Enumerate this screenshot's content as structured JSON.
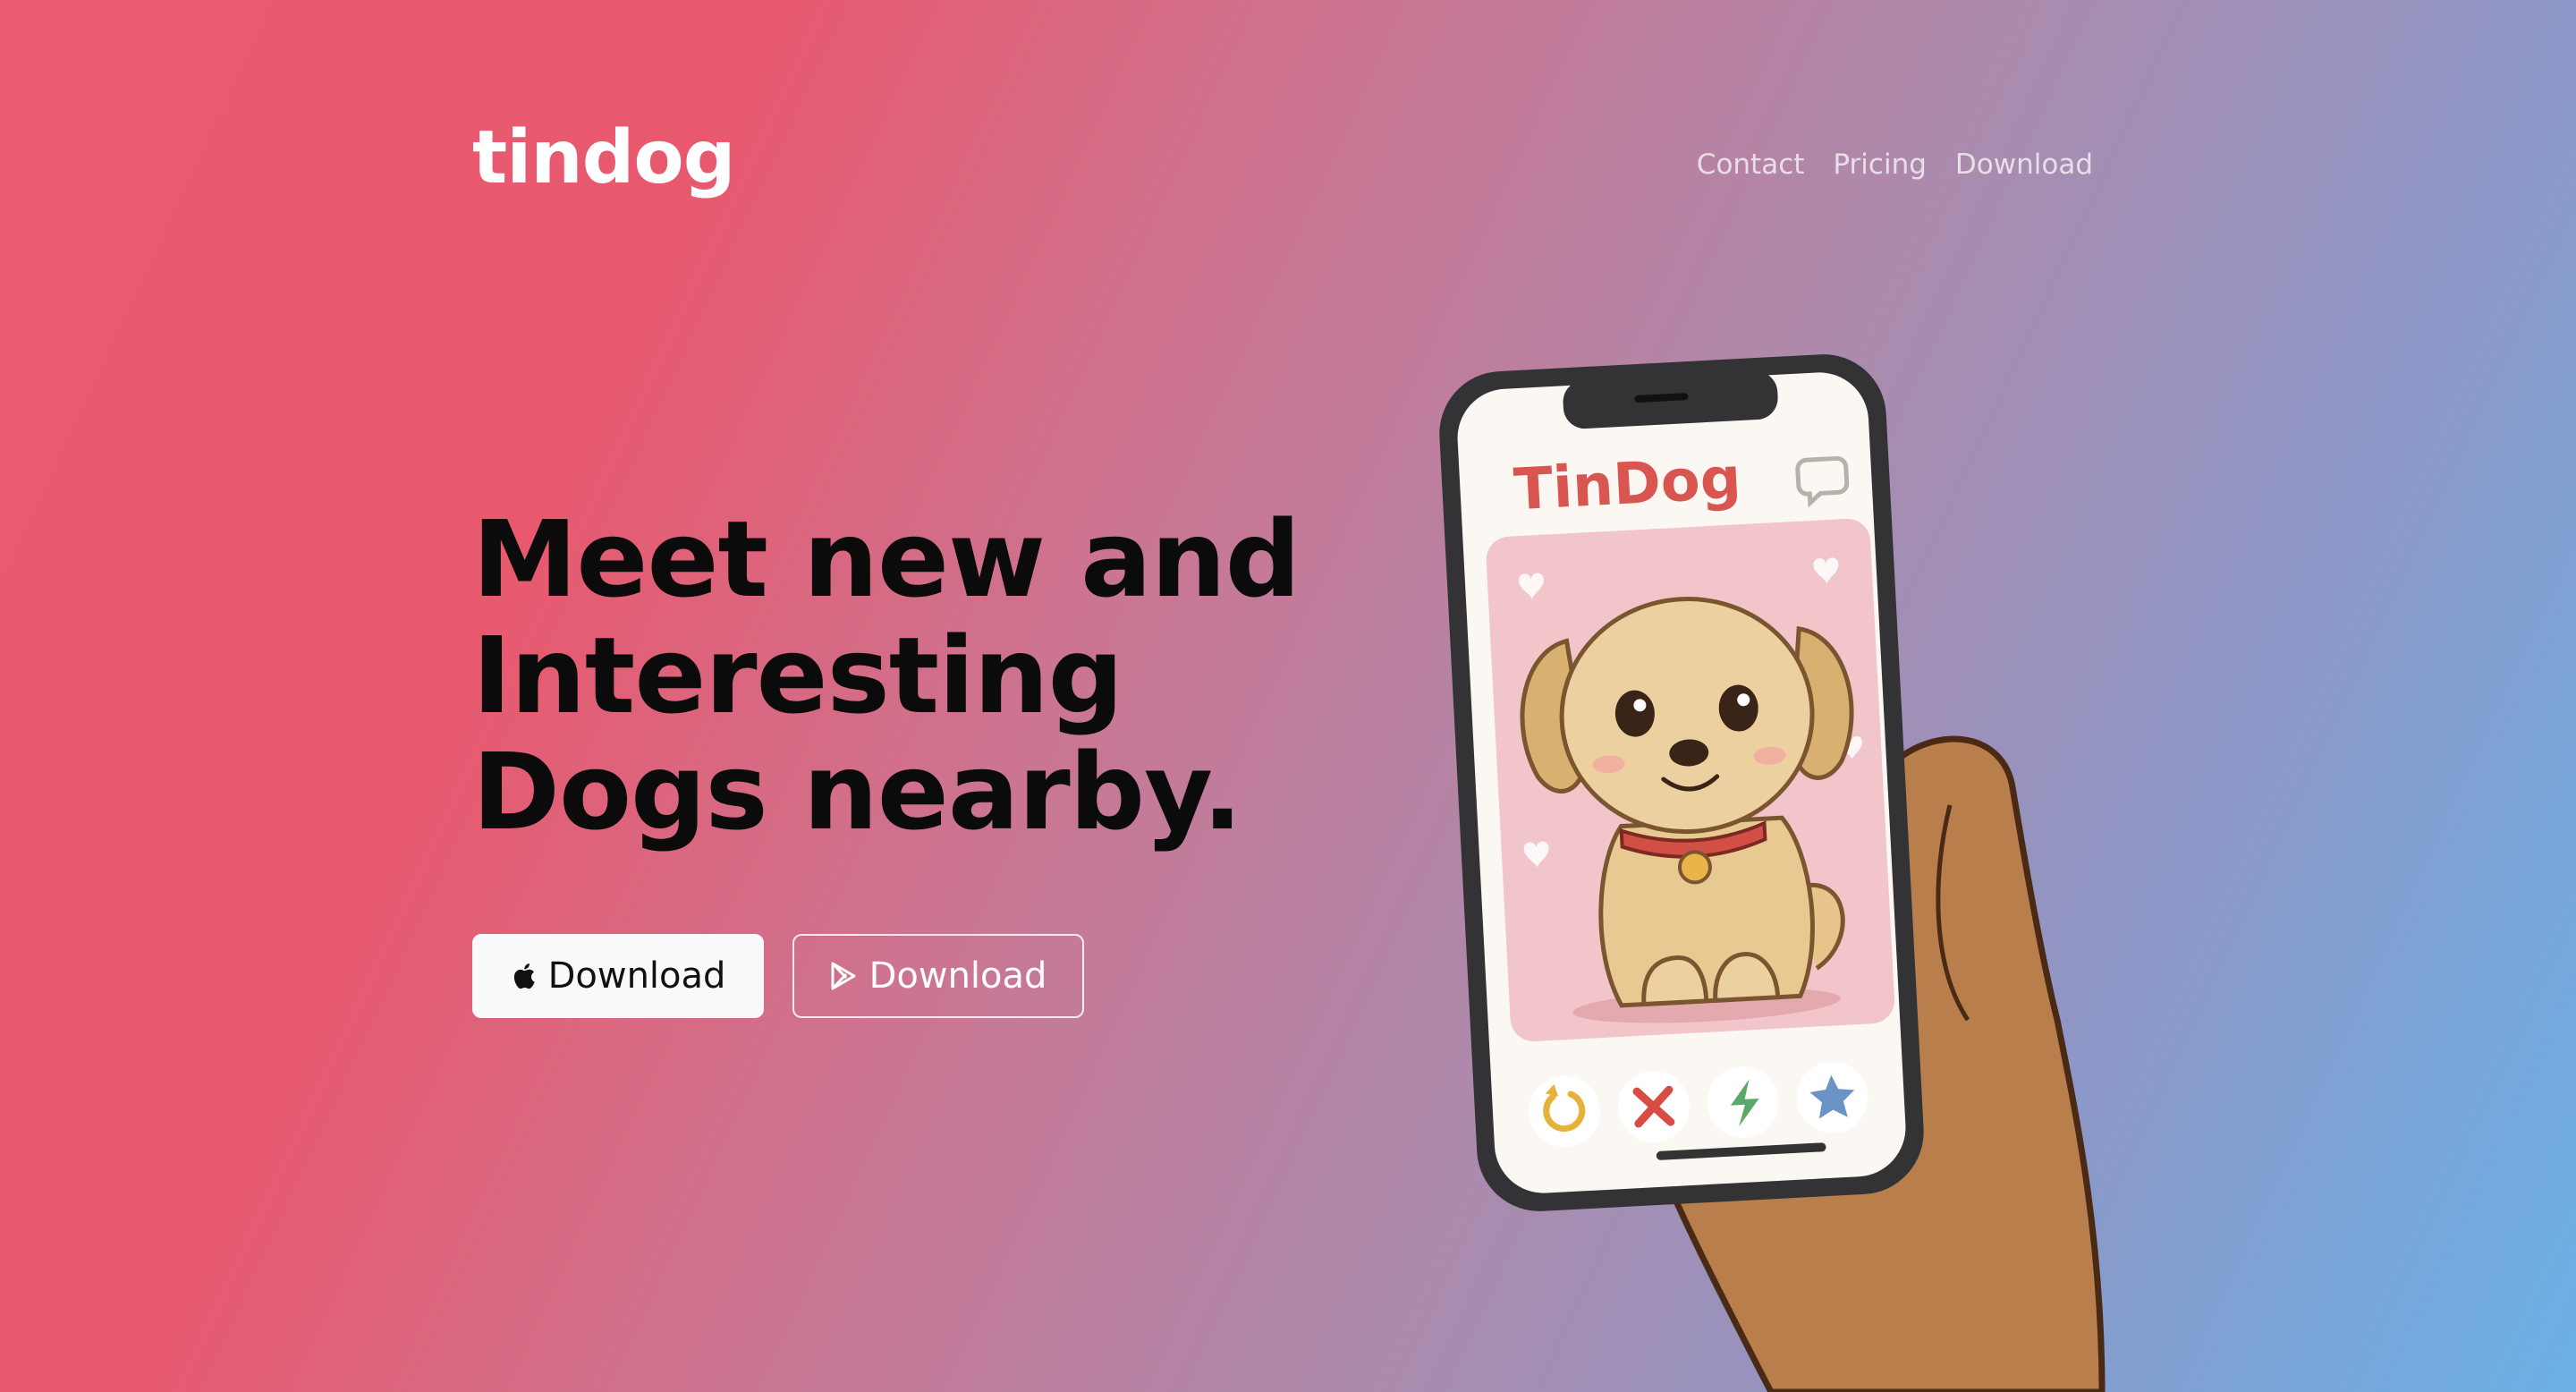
{
  "brand": {
    "name": "tindog"
  },
  "nav": {
    "items": [
      "Contact",
      "Pricing",
      "Download"
    ]
  },
  "hero": {
    "headline_lines": [
      "Meet new and",
      "Interesting",
      "Dogs nearby."
    ],
    "buttons": [
      {
        "label": "Download",
        "icon": "apple-icon"
      },
      {
        "label": "Download",
        "icon": "google-play-icon"
      }
    ]
  },
  "phone": {
    "app_title": "TinDog",
    "action_icons": [
      "undo-icon",
      "close-icon",
      "lightning-icon",
      "star-icon"
    ]
  },
  "colors": {
    "gradient_start": "#ea5b72",
    "gradient_end": "#6ab0e6",
    "app_title": "#d8564f",
    "button_primary_bg": "#f9f9fb",
    "headline": "#0b0b0b"
  }
}
